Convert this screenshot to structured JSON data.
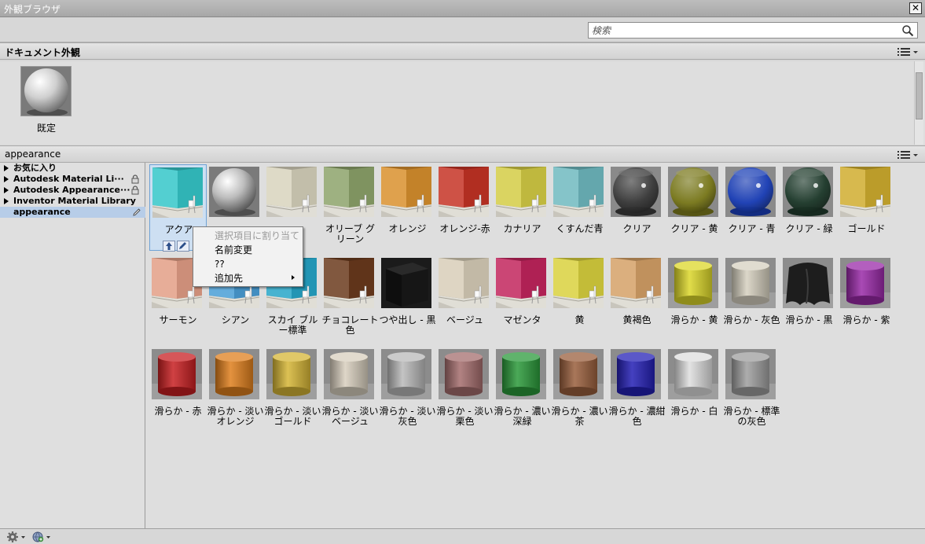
{
  "window": {
    "title": "外観ブラウザ",
    "close_label": "✕"
  },
  "search": {
    "placeholder": "検索",
    "value": ""
  },
  "document_section": {
    "title": "ドキュメント外観",
    "items": [
      {
        "label": "既定",
        "kind": "sphere",
        "color": "#c8c8c8"
      }
    ]
  },
  "library_section": {
    "title": "appearance"
  },
  "tree": {
    "items": [
      {
        "label": "お気に入り",
        "expandable": true,
        "locked": false
      },
      {
        "label": "Autodesk Material Li···",
        "expandable": true,
        "locked": true
      },
      {
        "label": "Autodesk Appearance···",
        "expandable": true,
        "locked": true
      },
      {
        "label": "Inventor Material Library",
        "expandable": true,
        "locked": false
      },
      {
        "label": "appearance",
        "expandable": false,
        "locked": false,
        "selected": true
      }
    ]
  },
  "materials": [
    {
      "label": "アクア",
      "kind": "wall",
      "color": "#35c7c9",
      "selected": true
    },
    {
      "label": "",
      "kind": "sphere",
      "color": "#bdbdbd"
    },
    {
      "label": "",
      "kind": "wall",
      "color": "#d8d3bd"
    },
    {
      "label": "オリーブ グリーン",
      "kind": "wall",
      "color": "#8da36b"
    },
    {
      "label": "オレンジ",
      "kind": "wall",
      "color": "#d9902e"
    },
    {
      "label": "オレンジ-赤",
      "kind": "wall",
      "color": "#c53325"
    },
    {
      "label": "カナリア",
      "kind": "wall",
      "color": "#d4cc45"
    },
    {
      "label": "くすんだ青",
      "kind": "wall",
      "color": "#6fb9c0"
    },
    {
      "label": "クリア",
      "kind": "glass",
      "color": "#3a3a3a"
    },
    {
      "label": "クリア - 黄",
      "kind": "glass",
      "color": "#7b7a1c"
    },
    {
      "label": "クリア - 青",
      "kind": "glass",
      "color": "#1b3fb8"
    },
    {
      "label": "クリア - 緑",
      "kind": "glass",
      "color": "#1f3b2c"
    },
    {
      "label": "ゴールド",
      "kind": "wall",
      "color": "#d0ad2f"
    },
    {
      "label": "サーモン",
      "kind": "wall",
      "color": "#e39e86"
    },
    {
      "label": "シアン",
      "kind": "wall",
      "color": "#4a9ed6"
    },
    {
      "label": "スカイ ブルー標準",
      "kind": "wall",
      "color": "#26a6c8"
    },
    {
      "label": "チョコレート色",
      "kind": "wall",
      "color": "#6b3a1d"
    },
    {
      "label": "つや出し - 黒",
      "kind": "block",
      "color": "#141414"
    },
    {
      "label": "ベージュ",
      "kind": "wall",
      "color": "#d8ceb8"
    },
    {
      "label": "マゼンタ",
      "kind": "wall",
      "color": "#c2255d"
    },
    {
      "label": "黄",
      "kind": "wall",
      "color": "#d9d13e"
    },
    {
      "label": "黄褐色",
      "kind": "wall",
      "color": "#d5a167"
    },
    {
      "label": "滑らか - 黄",
      "kind": "cylinder",
      "color": "#dcd72a"
    },
    {
      "label": "滑らか - 灰色",
      "kind": "cylinder",
      "color": "#d6d0c0"
    },
    {
      "label": "滑らか - 黒",
      "kind": "cloth",
      "color": "#1d1d1d"
    },
    {
      "label": "滑らか - 紫",
      "kind": "cylinder",
      "color": "#9a2aa8"
    },
    {
      "label": "滑らか - 赤",
      "kind": "cylinder",
      "color": "#c81f22"
    },
    {
      "label": "滑らか - 淡いオレンジ",
      "kind": "cylinder",
      "color": "#df7f1d"
    },
    {
      "label": "滑らか - 淡いゴールド",
      "kind": "cylinder",
      "color": "#d6b636"
    },
    {
      "label": "滑らか - 淡いベージュ",
      "kind": "cylinder",
      "color": "#d8cfbe"
    },
    {
      "label": "滑らか - 淡い灰色",
      "kind": "cylinder",
      "color": "#b9b9b9"
    },
    {
      "label": "滑らか - 淡い栗色",
      "kind": "cylinder",
      "color": "#a46d6d"
    },
    {
      "label": "滑らか - 濃い深緑",
      "kind": "cylinder",
      "color": "#2b9a3b"
    },
    {
      "label": "滑らか - 濃い茶",
      "kind": "cylinder",
      "color": "#9a5f3d"
    },
    {
      "label": "滑らか - 濃紺色",
      "kind": "cylinder",
      "color": "#2420b5"
    },
    {
      "label": "滑らか - 白",
      "kind": "cylinder",
      "color": "#dedede"
    },
    {
      "label": "滑らか - 標準の灰色",
      "kind": "cylinder",
      "color": "#9e9e9e"
    }
  ],
  "context_menu": {
    "items": [
      {
        "label": "選択項目に割り当て",
        "enabled": false
      },
      {
        "label": "名前変更",
        "enabled": true
      },
      {
        "label": "??",
        "enabled": true
      },
      {
        "label": "追加先",
        "enabled": true,
        "submenu": true
      }
    ]
  },
  "icons": {
    "search": "search-icon",
    "view_menu": "list-view-icon",
    "lock": "lock-icon",
    "edit": "pencil-icon",
    "gear": "gear-icon",
    "add_library": "globe-add-icon"
  }
}
